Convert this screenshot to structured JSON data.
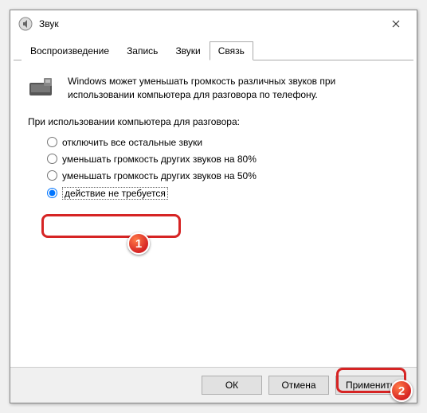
{
  "window": {
    "title": "Звук"
  },
  "tabs": {
    "playback": "Воспроизведение",
    "recording": "Запись",
    "sounds": "Звуки",
    "communications": "Связь"
  },
  "info": "Windows может уменьшать громкость различных звуков при использовании компьютера для разговора по телефону.",
  "subhead": "При использовании компьютера для разговора:",
  "options": {
    "mute": "отключить все остальные звуки",
    "reduce80": "уменьшать громкость других звуков на 80%",
    "reduce50": "уменьшать громкость других звуков на 50%",
    "none": "действие не требуется"
  },
  "buttons": {
    "ok": "ОК",
    "cancel": "Отмена",
    "apply": "Применить"
  },
  "callouts": {
    "one": "1",
    "two": "2"
  }
}
